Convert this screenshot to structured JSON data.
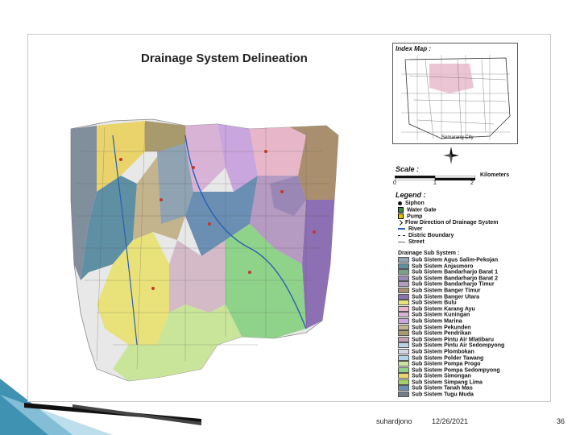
{
  "slide": {
    "title": "Drainage  System Delineation",
    "index_map": {
      "title": "Index Map :",
      "city_label": "Semarang City"
    },
    "scale": {
      "title": "Scale :",
      "ticks": [
        "0",
        "1",
        "2"
      ],
      "unit": "Kilometers"
    },
    "legend": {
      "title": "Legend :",
      "symbols": [
        {
          "label": "Siphon",
          "icon": "siphon-dot-icon"
        },
        {
          "label": "Water Gate",
          "icon": "water-gate-icon"
        },
        {
          "label": "Pump",
          "icon": "pump-icon"
        },
        {
          "label": "Flow Direction of Drainage System",
          "icon": "flow-arrow-icon"
        },
        {
          "label": "River",
          "icon": "river-line-icon"
        },
        {
          "label": "Distric Boundary",
          "icon": "boundary-line-icon"
        },
        {
          "label": "Street",
          "icon": "street-line-icon"
        }
      ],
      "subsystem_title": "Drainage Sub System :",
      "subsystems": [
        {
          "label": "Sub Sistem Agus Salim-Pekojan",
          "color": "#8fa3b3"
        },
        {
          "label": "Sub Sistem Anjasmoro",
          "color": "#5f8fa3"
        },
        {
          "label": "Sub Sistem Bandarharjo Barat 1",
          "color": "#7aa08a"
        },
        {
          "label": "Sub Sistem Bandarharjo Barat 2",
          "color": "#9b87b5"
        },
        {
          "label": "Sub Sistem Bandarharjo Timur",
          "color": "#b59ac2"
        },
        {
          "label": "Sub Sistem Banger Timur",
          "color": "#a98f6e"
        },
        {
          "label": "Sub Sistem Banger Utara",
          "color": "#8d6fb3"
        },
        {
          "label": "Sub Sistem Bulu",
          "color": "#e9e27a"
        },
        {
          "label": "Sub Sistem Karang Ayu",
          "color": "#e7b7c9"
        },
        {
          "label": "Sub Sistem Kuningan",
          "color": "#d9b3d6"
        },
        {
          "label": "Sub Sistem Marina",
          "color": "#c9a6dd"
        },
        {
          "label": "Sub Sistem Pekunden",
          "color": "#c3b48d"
        },
        {
          "label": "Sub Sistem Pendrikan",
          "color": "#a89a6c"
        },
        {
          "label": "Sub Sistem Pintu Air Mlatibaru",
          "color": "#c79bb1"
        },
        {
          "label": "Sub Sistem Pintu Air Sedompyong",
          "color": "#b7d2e3"
        },
        {
          "label": "Sub Sistem Plombokan",
          "color": "#d6d6e6"
        },
        {
          "label": "Sub Sistem Polder Tawang",
          "color": "#aed3ea"
        },
        {
          "label": "Sub Sistem Pompa Progo",
          "color": "#c9e59a"
        },
        {
          "label": "Sub Sistem Pompa Sedompyong",
          "color": "#8fd38a"
        },
        {
          "label": "Sub Sistem Simongan",
          "color": "#e9d36a"
        },
        {
          "label": "Sub Sistem Simpang Lima",
          "color": "#9fd36a"
        },
        {
          "label": "Sub Sistem Tanah Mas",
          "color": "#6a8fb3"
        },
        {
          "label": "Sub Sistem Tugu Muda",
          "color": "#6f7f8f"
        }
      ]
    },
    "footer": {
      "author": "suhardjono",
      "date": "12/26/2021",
      "page": "36"
    },
    "colors": {
      "accent_teal": "#1f7fa6",
      "accent_light": "#9fd0e6",
      "frame_border": "#c8c8c8"
    }
  }
}
